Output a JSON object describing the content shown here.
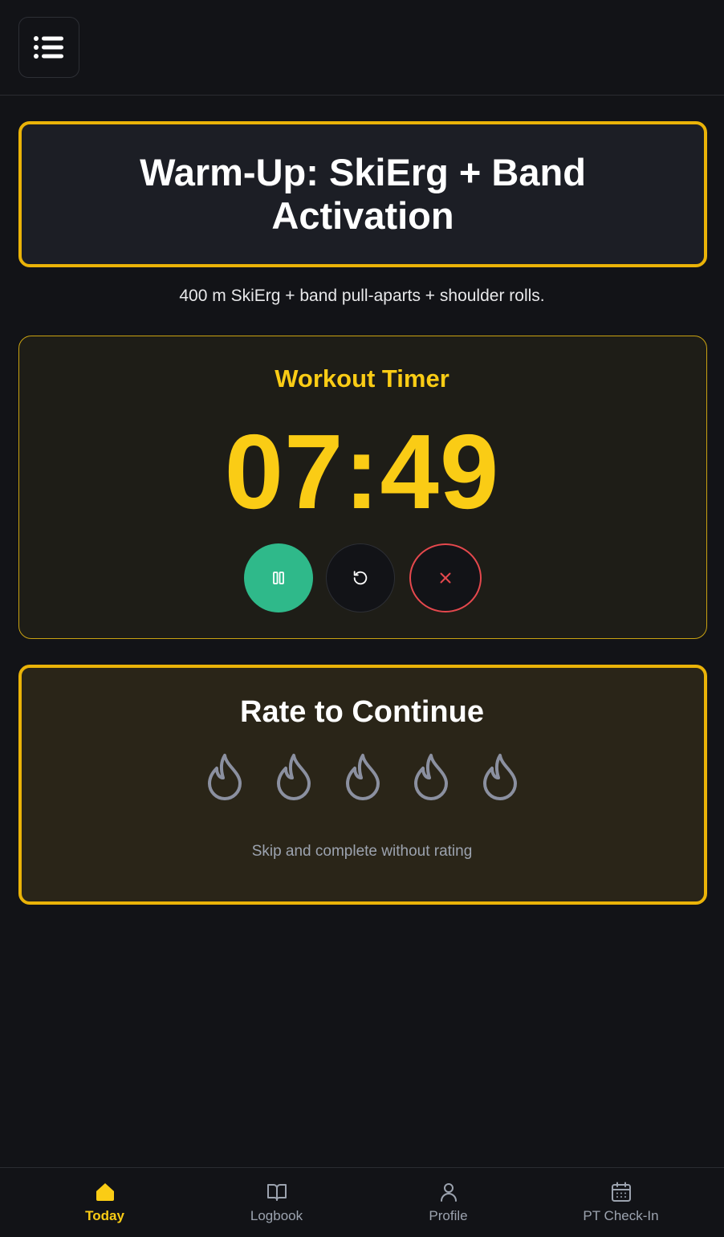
{
  "header": {
    "menu_icon": "list-icon"
  },
  "workout": {
    "title": "Warm-Up: SkiErg + Band Activation",
    "description": "400 m SkiErg + band pull-aparts + shoulder rolls."
  },
  "timer": {
    "label": "Workout Timer",
    "value": "07:49",
    "controls": {
      "pause_icon": "pause-icon",
      "reset_icon": "reset-icon",
      "stop_icon": "close-icon"
    }
  },
  "rating": {
    "title": "Rate to Continue",
    "flame_count": 5,
    "selected": 0,
    "skip_label": "Skip and complete without rating"
  },
  "nav": {
    "items": [
      {
        "label": "Today",
        "icon": "home-icon",
        "active": true
      },
      {
        "label": "Logbook",
        "icon": "book-icon",
        "active": false
      },
      {
        "label": "Profile",
        "icon": "user-icon",
        "active": false
      },
      {
        "label": "PT Check-In",
        "icon": "calendar-icon",
        "active": false
      }
    ]
  },
  "colors": {
    "background": "#121317",
    "accent": "#facc15",
    "card_border": "#eab308",
    "play": "#2fb98a",
    "danger": "#e5484d",
    "muted": "#9ca3af"
  }
}
